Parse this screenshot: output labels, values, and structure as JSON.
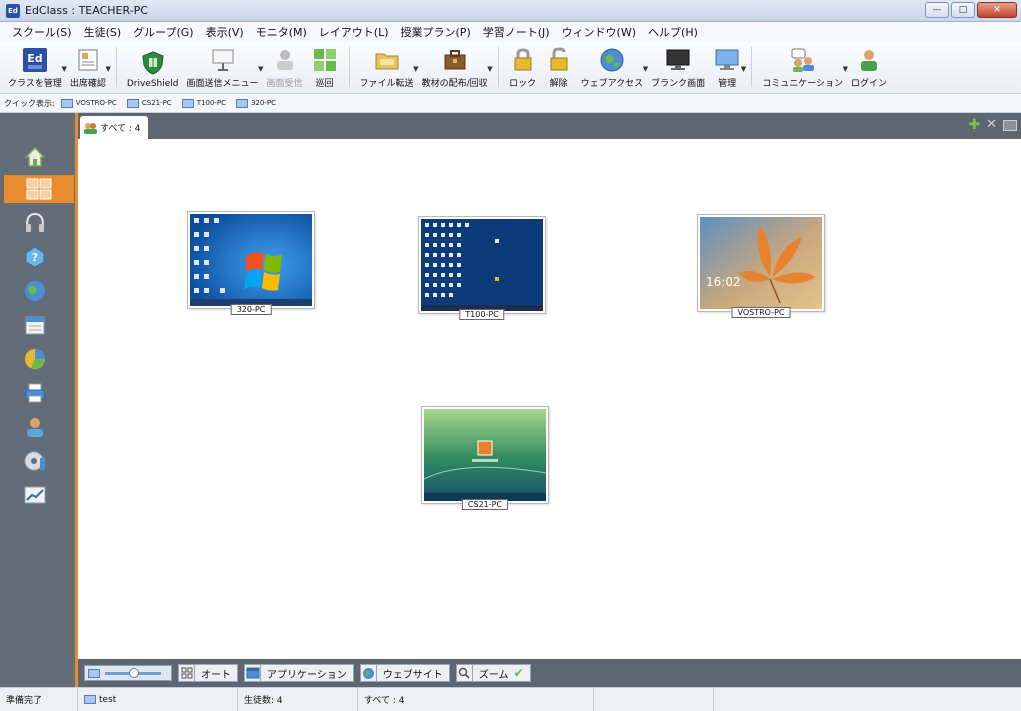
{
  "window": {
    "title": "EdClass : TEACHER-PC",
    "icon_text": "Ed"
  },
  "menu": [
    "スクール(S)",
    "生徒(S)",
    "グループ(G)",
    "表示(V)",
    "モニタ(M)",
    "レイアウト(L)",
    "授業プラン(P)",
    "学習ノート(J)",
    "ウィンドウ(W)",
    "ヘルプ(H)"
  ],
  "toolbar": {
    "class_manage": "クラスを管理",
    "attendance": "出席確認",
    "driveshield": "DriveShield",
    "screen_send_menu": "画面送信メニュー",
    "screen_receive": "画面受信",
    "tour": "巡回",
    "file_transfer": "ファイル転送",
    "material_distribute": "教材の配布/回収",
    "lock": "ロック",
    "unlock": "解除",
    "web_access": "ウェブアクセス",
    "blank_screen": "ブランク画面",
    "manage": "管理",
    "communication": "コミュニケーション",
    "login": "ログイン"
  },
  "quickbar": {
    "label": "クイック表示:",
    "items": [
      "VOSTRO-PC",
      "CS21-PC",
      "T100-PC",
      "320-PC"
    ]
  },
  "tab": {
    "label": "すべて : 4"
  },
  "thumbnails": [
    {
      "label": "320-PC"
    },
    {
      "label": "T100-PC"
    },
    {
      "label": "VOSTRO-PC",
      "clock": "16:02"
    },
    {
      "label": "CS21-PC"
    }
  ],
  "bottombar": {
    "auto": "オート",
    "application": "アプリケーション",
    "website": "ウェブサイト",
    "zoom": "ズーム"
  },
  "status": {
    "ready": "準備完了",
    "class_name": "test",
    "student_count": "生徒数: 4",
    "all": "すべて : 4"
  },
  "colors": {
    "accent": "#e98b2f",
    "sidebar": "#636c77",
    "monitor_blue": "#1f5fb0"
  }
}
